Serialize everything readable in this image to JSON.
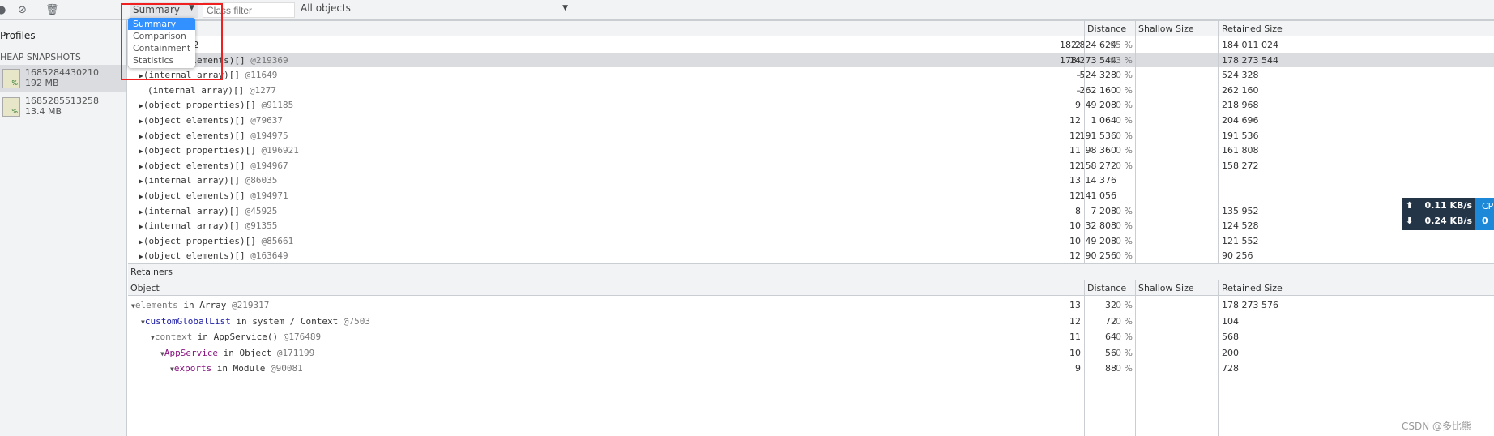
{
  "toolbar": {
    "record_icon": "record-icon",
    "clear_icon": "clear-icon",
    "delete_icon": "trash-icon",
    "view_select": "Summary",
    "class_filter_placeholder": "Class filter",
    "objects_select": "All objects"
  },
  "view_menu": [
    "Summary",
    "Comparison",
    "Containment",
    "Statistics"
  ],
  "sidebar": {
    "title": "Profiles",
    "section": "HEAP SNAPSHOTS",
    "snapshots": [
      {
        "name": "1685284430210",
        "size": "192 MB"
      },
      {
        "name": "1685285513258",
        "size": "13.4 MB"
      }
    ]
  },
  "columns": {
    "distance": "Distance",
    "shallow": "Shallow Size",
    "retained": "Retained Size"
  },
  "rows": [
    {
      "name": "02",
      "dist": "2",
      "shallow": "182 824 624",
      "sp": "95 %",
      "retained": "184 011 024"
    },
    {
      "name": "(object elements)[] ",
      "id": "@219369",
      "dist": "14",
      "shallow": "178 273 544",
      "sp": "93 %",
      "retained": "178 273 544"
    },
    {
      "name": "(internal array)[] ",
      "id": "@11649",
      "dist": "–",
      "shallow": "524 328",
      "sp": "0 %",
      "retained": "524 328"
    },
    {
      "name": "(internal array)[] ",
      "id": "@1277",
      "dist": "–",
      "shallow": "262 160",
      "sp": "0 %",
      "retained": "262 160"
    },
    {
      "name": "(object properties)[] ",
      "id": "@91185",
      "dist": "9",
      "shallow": "49 208",
      "sp": "0 %",
      "retained": "218 968"
    },
    {
      "name": "(object elements)[] ",
      "id": "@79637",
      "dist": "12",
      "shallow": "1 064",
      "sp": "0 %",
      "retained": "204 696"
    },
    {
      "name": "(object elements)[] ",
      "id": "@194975",
      "dist": "12",
      "shallow": "191 536",
      "sp": "0 %",
      "retained": "191 536"
    },
    {
      "name": "(object properties)[] ",
      "id": "@196921",
      "dist": "11",
      "shallow": "98 360",
      "sp": "0 %",
      "retained": "161 808"
    },
    {
      "name": "(object elements)[] ",
      "id": "@194967",
      "dist": "12",
      "shallow": "158 272",
      "sp": "0 %",
      "retained": "158 272"
    },
    {
      "name": "(internal array)[] ",
      "id": "@86035",
      "dist": "13",
      "shallow": "14 376",
      "sp": "",
      "retained": ""
    },
    {
      "name": "(object elements)[] ",
      "id": "@194971",
      "dist": "12",
      "shallow": "141 056",
      "sp": "",
      "retained": ""
    },
    {
      "name": "(internal array)[] ",
      "id": "@45925",
      "dist": "8",
      "shallow": "7 208",
      "sp": "0 %",
      "retained": "135 952"
    },
    {
      "name": "(internal array)[] ",
      "id": "@91355",
      "dist": "10",
      "shallow": "32 808",
      "sp": "0 %",
      "retained": "124 528"
    },
    {
      "name": "(object properties)[] ",
      "id": "@85661",
      "dist": "10",
      "shallow": "49 208",
      "sp": "0 %",
      "retained": "121 552"
    },
    {
      "name": "(object elements)[] ",
      "id": "@163649",
      "dist": "12",
      "shallow": "90 256",
      "sp": "0 %",
      "retained": "90 256"
    }
  ],
  "retainers": {
    "title": "Retainers",
    "object_col": "Object",
    "rows": [
      {
        "key": "elements",
        "rest": " in Array ",
        "id": "@219317",
        "dist": "13",
        "shallow": "32",
        "sp": "0 %",
        "retained": "178 273 576",
        "color": "#777"
      },
      {
        "key": "customGlobalList",
        "rest": " in system / Context ",
        "id": "@7503",
        "dist": "12",
        "shallow": "72",
        "sp": "0 %",
        "retained": "104",
        "color": "#1a1aa6"
      },
      {
        "key": "context",
        "rest": " in AppService() ",
        "id": "@176489",
        "dist": "11",
        "shallow": "64",
        "sp": "0 %",
        "retained": "568",
        "color": "#777"
      },
      {
        "key": "AppService",
        "rest": " in Object ",
        "id": "@171199",
        "dist": "10",
        "shallow": "56",
        "sp": "0 %",
        "retained": "200",
        "color": "#881280"
      },
      {
        "key": "exports",
        "rest": " in Module ",
        "id": "@90081",
        "dist": "9",
        "shallow": "88",
        "sp": "0 %",
        "retained": "728",
        "color": "#881280"
      }
    ]
  },
  "net_overlay": {
    "up": "0.11 KB/s",
    "down": "0.24 KB/s",
    "cpu_label": "CP",
    "cpu_value": "0"
  },
  "watermark": "CSDN @多比熊"
}
